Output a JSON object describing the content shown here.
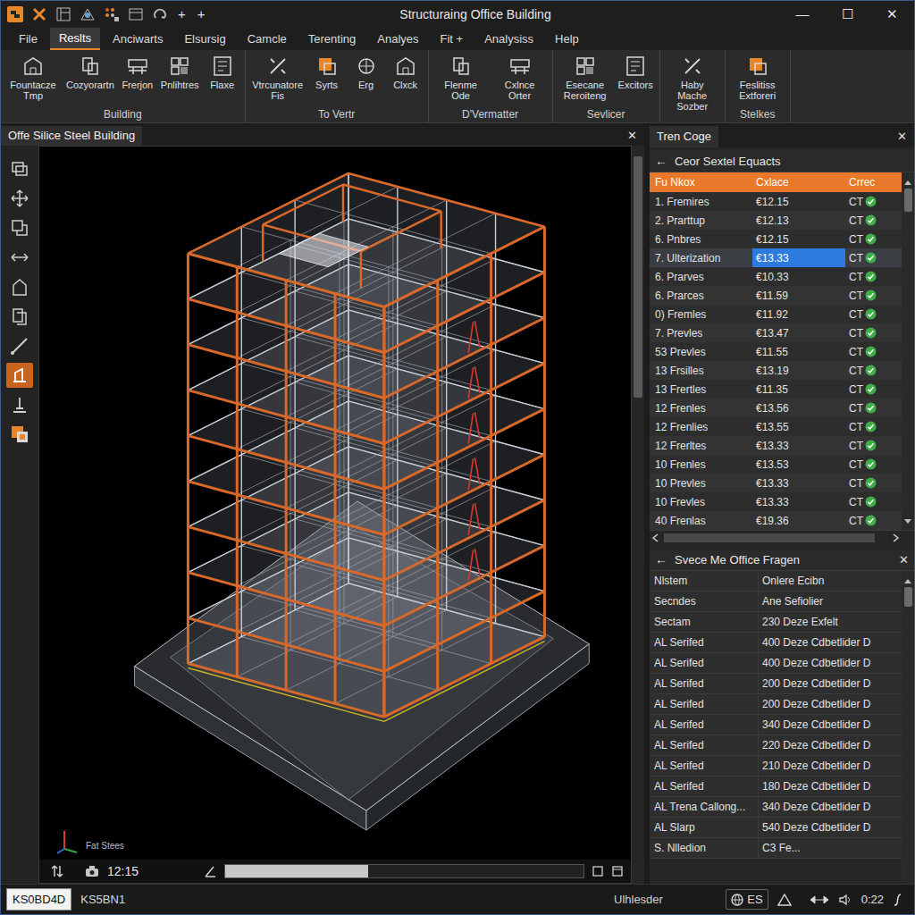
{
  "window": {
    "title": "Structuraing Office Building",
    "quick_access": [
      "+",
      "+"
    ],
    "controls": [
      "—",
      "☐",
      "✕"
    ]
  },
  "menu": [
    {
      "label": "File",
      "selected": false
    },
    {
      "label": "Reslts",
      "selected": true
    },
    {
      "label": "Anciwarts",
      "selected": false
    },
    {
      "label": "Elsursig",
      "selected": false
    },
    {
      "label": "Camcle",
      "selected": false
    },
    {
      "label": "Terenting",
      "selected": false
    },
    {
      "label": "Analyes",
      "selected": false
    },
    {
      "label": "Fit +",
      "selected": false
    },
    {
      "label": "Analysiss",
      "selected": false
    },
    {
      "label": "Help",
      "selected": false
    }
  ],
  "ribbon": {
    "groups": [
      {
        "label": "Building",
        "buttons": [
          "Fountacze Tmp",
          "Cozyorartn",
          "Frerjon",
          "Pnlihtres",
          "Flaxe"
        ]
      },
      {
        "label": "To Vertr",
        "buttons": [
          "Vtrcunatore Fis",
          "Syrts",
          "Erg",
          "Clxck"
        ]
      },
      {
        "label": "D'Vermatter",
        "buttons": [
          "Flenme Ode",
          "Cxlnce Orter"
        ]
      },
      {
        "label": "Sevlicer",
        "buttons": [
          "Esecane Reroiteng",
          "Excitors"
        ]
      },
      {
        "buttons": [
          "Haby Mache Sozber"
        ]
      },
      {
        "label": "Stelkes",
        "buttons": [
          "Feslitiss Extforeri"
        ]
      }
    ]
  },
  "tools": [
    {
      "selected": false
    },
    {
      "selected": false
    },
    {
      "selected": false
    },
    {
      "selected": false
    },
    {
      "selected": false
    },
    {
      "selected": false
    },
    {
      "selected": false
    },
    {
      "selected": true
    },
    {
      "selected": false
    },
    {
      "selected": false
    }
  ],
  "viewport": {
    "tab": "Offe Silice Steel Building",
    "close": "✕",
    "axis_label": "Fat Stees",
    "time": "12:15"
  },
  "panel": {
    "tab": "Tren Coge",
    "close": "✕",
    "results": {
      "back": "←",
      "title": "Ceor Sextel Equacts",
      "columns": [
        "Fu Nkox",
        "Cxlace",
        "Crrec"
      ],
      "rows": [
        {
          "name": "1. Fremires",
          "value": "€12.15",
          "code": "CT",
          "selected": false
        },
        {
          "name": "2. Prarttup",
          "value": "€12.13",
          "code": "CT",
          "selected": false
        },
        {
          "name": "6. Pnbres",
          "value": "€12.15",
          "code": "CT",
          "selected": false
        },
        {
          "name": "7. Ulterization",
          "value": "€13.33",
          "code": "CT",
          "selected": true
        },
        {
          "name": "6. Prarves",
          "value": "€10.33",
          "code": "CT",
          "selected": false
        },
        {
          "name": "6. Prarces",
          "value": "€11.59",
          "code": "CT",
          "selected": false
        },
        {
          "name": "0) Fremles",
          "value": "€11.92",
          "code": "CT",
          "selected": false
        },
        {
          "name": "7. Prevles",
          "value": "€13.47",
          "code": "CT",
          "selected": false
        },
        {
          "name": "53 Prevles",
          "value": "€11.55",
          "code": "CT",
          "selected": false
        },
        {
          "name": "13 Frsilles",
          "value": "€13.19",
          "code": "CT",
          "selected": false
        },
        {
          "name": "13 Frertles",
          "value": "€11.35",
          "code": "CT",
          "selected": false
        },
        {
          "name": "12 Frenles",
          "value": "€13.56",
          "code": "CT",
          "selected": false
        },
        {
          "name": "12 Frenlies",
          "value": "€13.55",
          "code": "CT",
          "selected": false
        },
        {
          "name": "12 Frerltes",
          "value": "€13.33",
          "code": "CT",
          "selected": false
        },
        {
          "name": "10 Frenles",
          "value": "€13.53",
          "code": "CT",
          "selected": false
        },
        {
          "name": "10 Prevles",
          "value": "€13.33",
          "code": "CT",
          "selected": false
        },
        {
          "name": "10 Frevles",
          "value": "€13.33",
          "code": "CT",
          "selected": false
        },
        {
          "name": "40 Frenlas",
          "value": "€19.36",
          "code": "CT",
          "selected": false
        }
      ]
    },
    "details": {
      "back": "←",
      "title": "Svece Me Office Fragen",
      "close": "✕",
      "rows": [
        [
          "Nlstem",
          "Onlere Ecibn"
        ],
        [
          "Secndes",
          "Ane Sefiolier"
        ],
        [
          "Sectam",
          "230 Deze Exfelt"
        ],
        [
          "AL Serifed",
          "400 Deze Cdbetlider D"
        ],
        [
          "AL Serifed",
          "400 Deze Cdbetlider D"
        ],
        [
          "AL Serifed",
          "200 Deze Cdbetlider D"
        ],
        [
          "AL Serifed",
          "200 Deze Cdbetlider D"
        ],
        [
          "AL Serifed",
          "340 Deze Cdbetlider D"
        ],
        [
          "AL Serifed",
          "220 Deze Cdbetlider D"
        ],
        [
          "AL Serifed",
          "210 Deze Cdbetlider D"
        ],
        [
          "AL Serifed",
          "180 Deze Cdbetlider D"
        ],
        [
          "AL Trena Callong...",
          "340 Deze Cdbetlider D"
        ],
        [
          "AL Slarp",
          "540 Deze Cdbetlider D"
        ],
        [
          "S. Nlledion",
          "C3 Fe..."
        ]
      ]
    }
  },
  "status_bar": {
    "left": "KS0BD4D",
    "code": "KS5BN1",
    "center": "Ulhlesder",
    "lang": "ES",
    "clock": "0:22"
  }
}
